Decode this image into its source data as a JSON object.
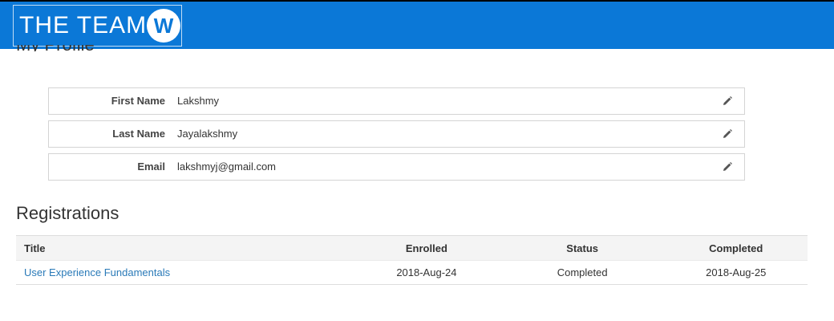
{
  "header": {
    "logo_text": "THE TEAM",
    "logo_mark_letter": "W",
    "background_color": "#0b78d7"
  },
  "page": {
    "clipped_title": "My Profile"
  },
  "profile": {
    "fields": [
      {
        "label": "First Name",
        "value": "Lakshmy",
        "icon": "pencil-icon"
      },
      {
        "label": "Last Name",
        "value": "Jayalakshmy",
        "icon": "pencil-icon"
      },
      {
        "label": "Email",
        "value": "lakshmyj@gmail.com",
        "icon": "pencil-icon"
      }
    ]
  },
  "registrations": {
    "title": "Registrations",
    "columns": {
      "title": "Title",
      "enrolled": "Enrolled",
      "status": "Status",
      "completed": "Completed"
    },
    "rows": [
      {
        "title": "User Experience Fundamentals",
        "enrolled": "2018-Aug-24",
        "status": "Completed",
        "completed": "2018-Aug-25"
      }
    ],
    "link_color": "#2a7ab8"
  }
}
